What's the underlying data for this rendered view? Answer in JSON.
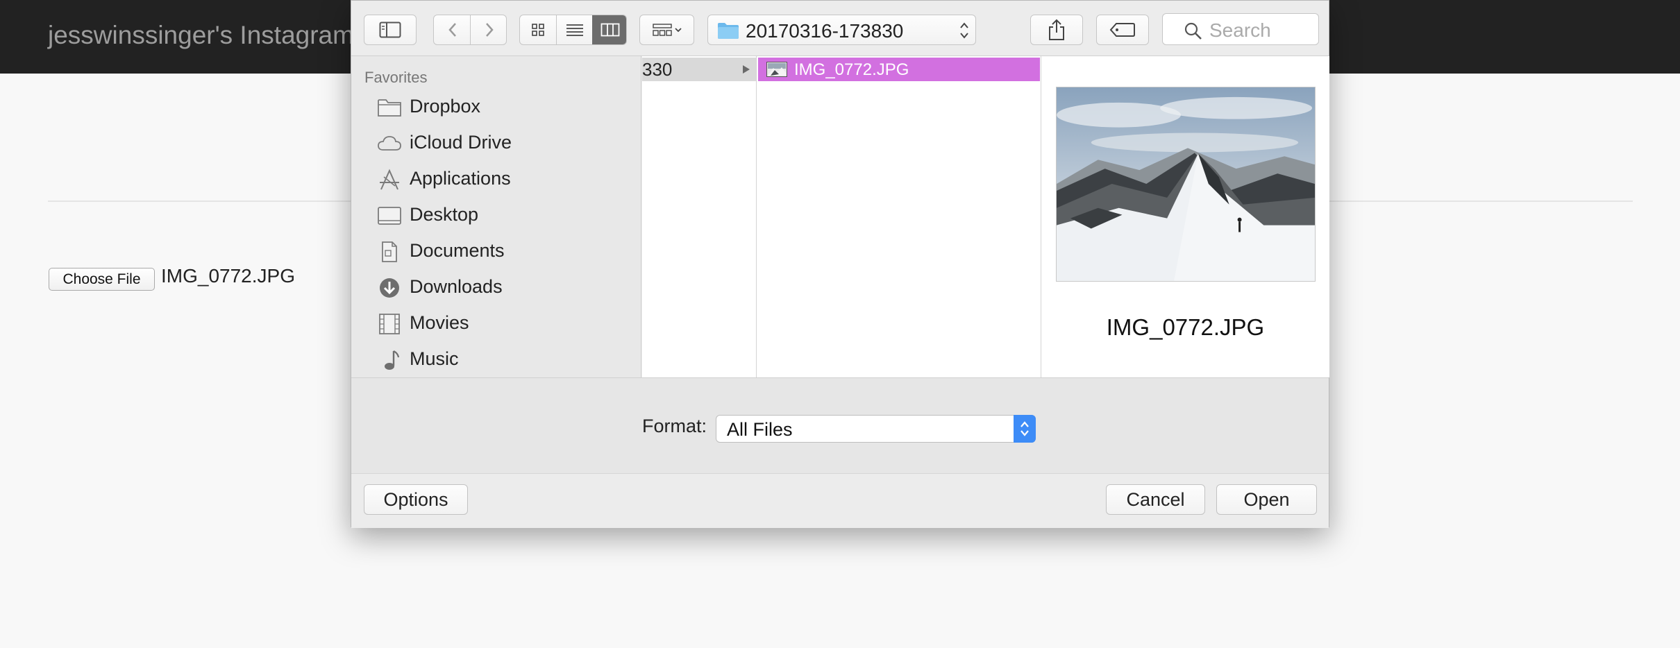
{
  "page": {
    "brand": "jesswinssinger's Instagram",
    "choose_file_label": "Choose File",
    "chosen_file": "IMG_0772.JPG"
  },
  "dialog": {
    "toolbar": {
      "path_folder": "20170316-173830",
      "search_placeholder": "Search"
    },
    "sidebar": {
      "header": "Favorites",
      "items": [
        {
          "label": "Dropbox",
          "icon": "folder-icon"
        },
        {
          "label": "iCloud Drive",
          "icon": "cloud-icon"
        },
        {
          "label": "Applications",
          "icon": "applications-icon"
        },
        {
          "label": "Desktop",
          "icon": "desktop-icon"
        },
        {
          "label": "Documents",
          "icon": "documents-icon"
        },
        {
          "label": "Downloads",
          "icon": "downloads-icon"
        },
        {
          "label": "Movies",
          "icon": "movies-icon"
        },
        {
          "label": "Music",
          "icon": "music-icon"
        }
      ]
    },
    "browser": {
      "parent_column_item": "330",
      "selected_file": "IMG_0772.JPG",
      "selection_color": "#d270e0",
      "preview_name": "IMG_0772.JPG"
    },
    "format": {
      "label": "Format:",
      "value": "All Files"
    },
    "buttons": {
      "options": "Options",
      "cancel": "Cancel",
      "open": "Open"
    }
  }
}
